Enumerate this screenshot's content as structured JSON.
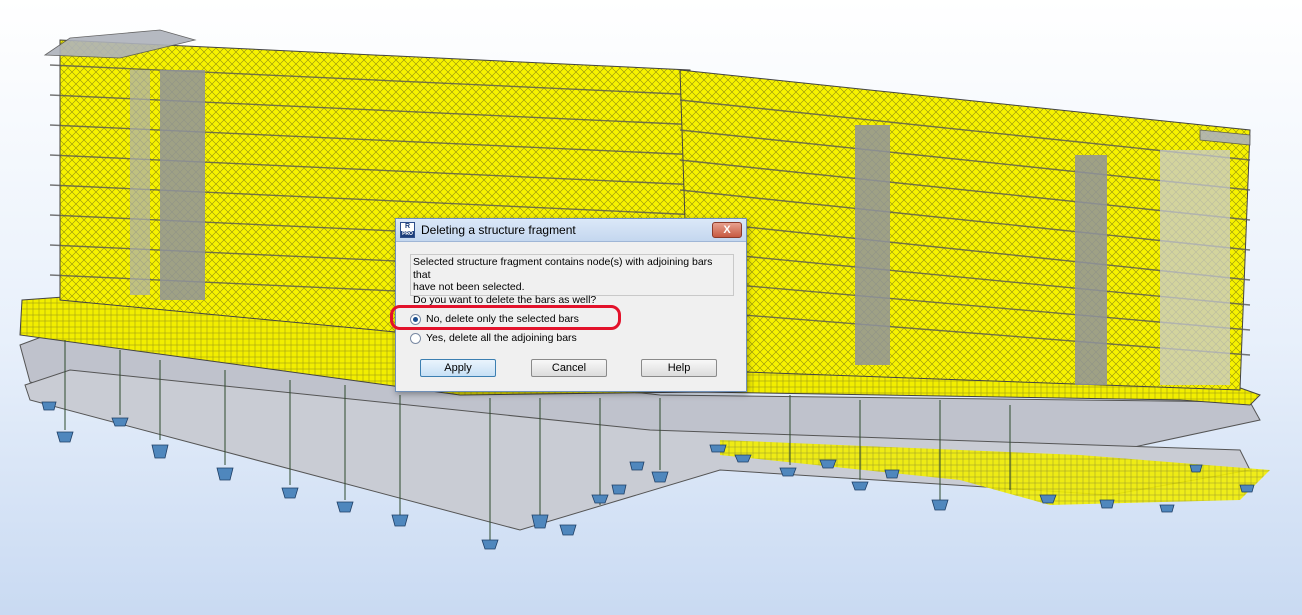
{
  "dialog": {
    "title": "Deleting a structure fragment",
    "close_label": "X",
    "app_icon_top": "R",
    "app_icon_bottom": "PRO",
    "message": {
      "line1": "Selected structure fragment contains node(s) with adjoining bars that",
      "line2": "have not been selected.",
      "line3": "Do you want to delete the bars as well?"
    },
    "options": [
      {
        "label": "No, delete only the selected bars",
        "selected": true
      },
      {
        "label": "Yes, delete all the adjoining bars",
        "selected": false
      }
    ],
    "buttons": {
      "apply": "Apply",
      "cancel": "Cancel",
      "help": "Help"
    }
  },
  "colors": {
    "mesh": "#f4f000",
    "slab": "#b9bcc6",
    "support": "#4f87bd",
    "highlight": "#e3122b"
  }
}
